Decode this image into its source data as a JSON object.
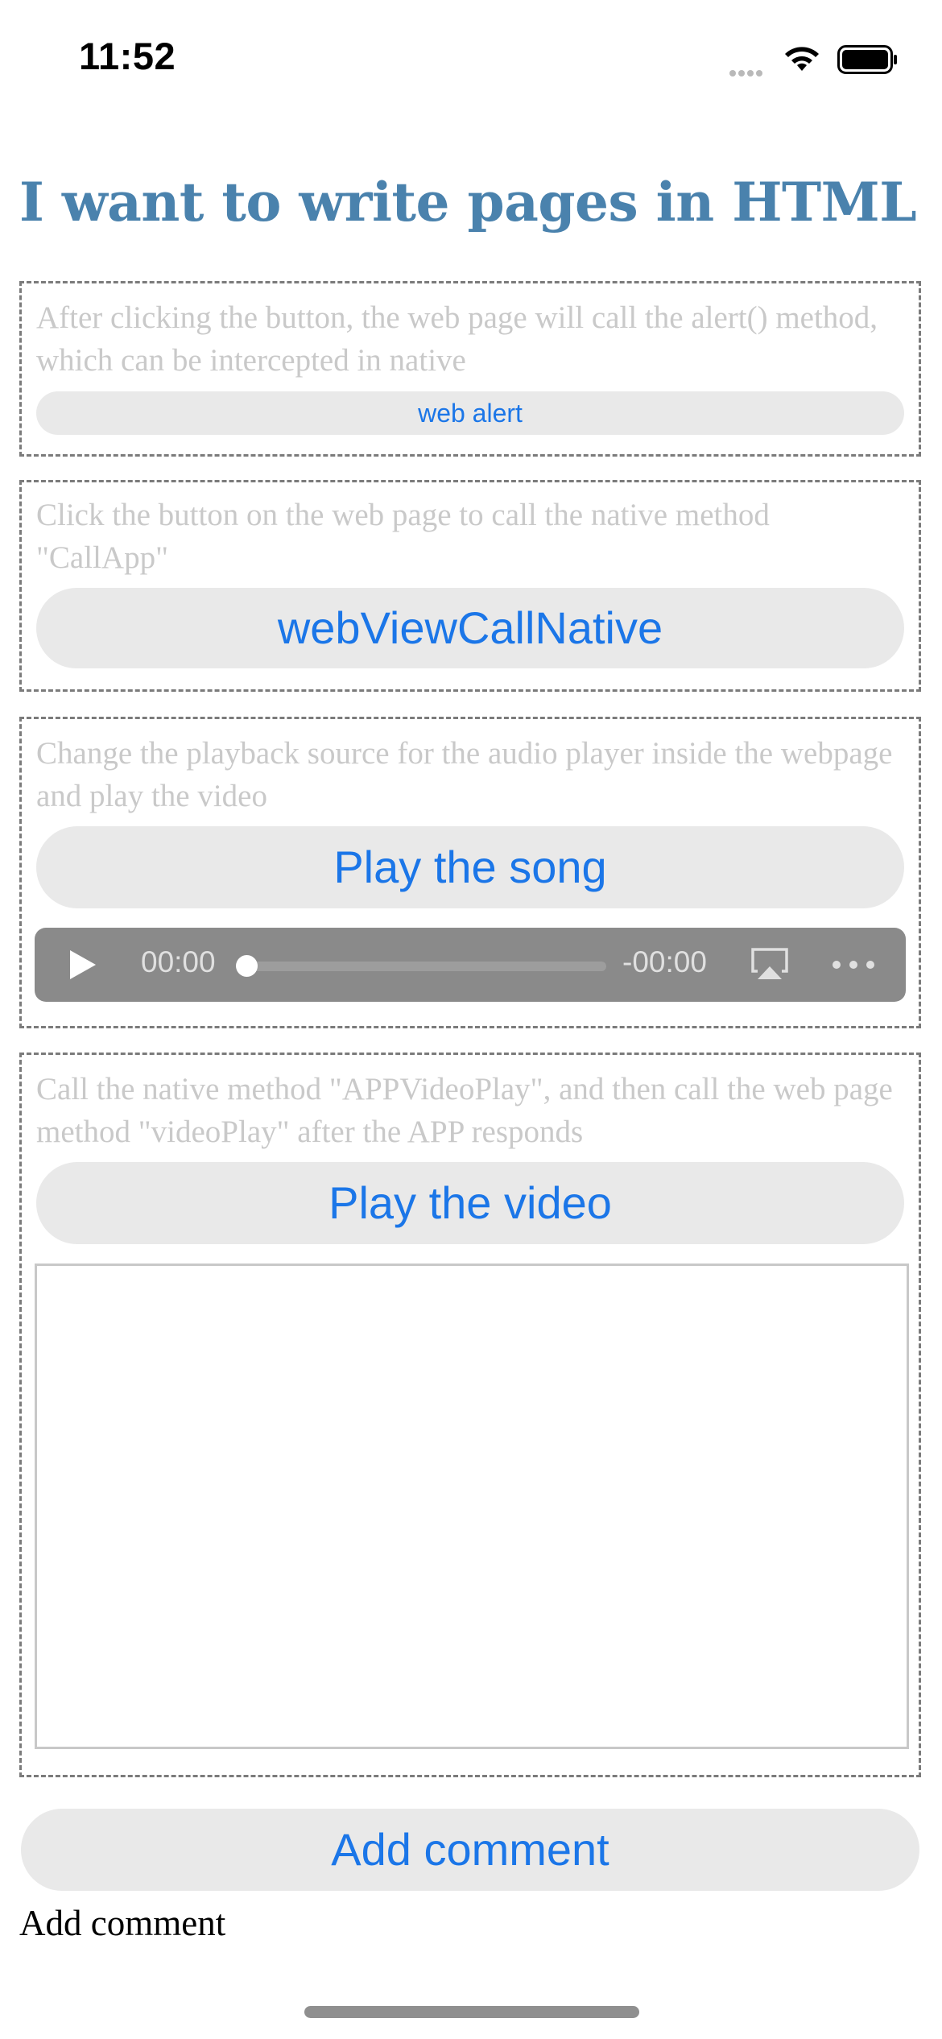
{
  "status_bar": {
    "time": "11:52"
  },
  "page": {
    "title": "I want to write pages in HTML"
  },
  "sections": [
    {
      "description": "After clicking the button, the web page will call the alert() method, which can be intercepted in native",
      "button_label": "web alert"
    },
    {
      "description": "Click the button on the web page to call the native method \"CallApp\"",
      "button_label": "webViewCallNative"
    },
    {
      "description": "Change the playback source for the audio player inside the webpage and play the video",
      "button_label": "Play the song",
      "audio_player": {
        "current_time": "00:00",
        "remaining_time": "-00:00",
        "progress": 0
      }
    },
    {
      "description": "Call the native method \"APPVideoPlay\", and then call the web page method \"videoPlay\" after the APP responds",
      "button_label": "Play the video"
    }
  ],
  "footer": {
    "add_comment_button": "Add comment",
    "add_comment_text": "Add comment"
  },
  "colors": {
    "title": "#4a82ad",
    "button_text": "#1b76e8",
    "button_bg": "#e9e9e9",
    "description": "#c9c9c9"
  }
}
